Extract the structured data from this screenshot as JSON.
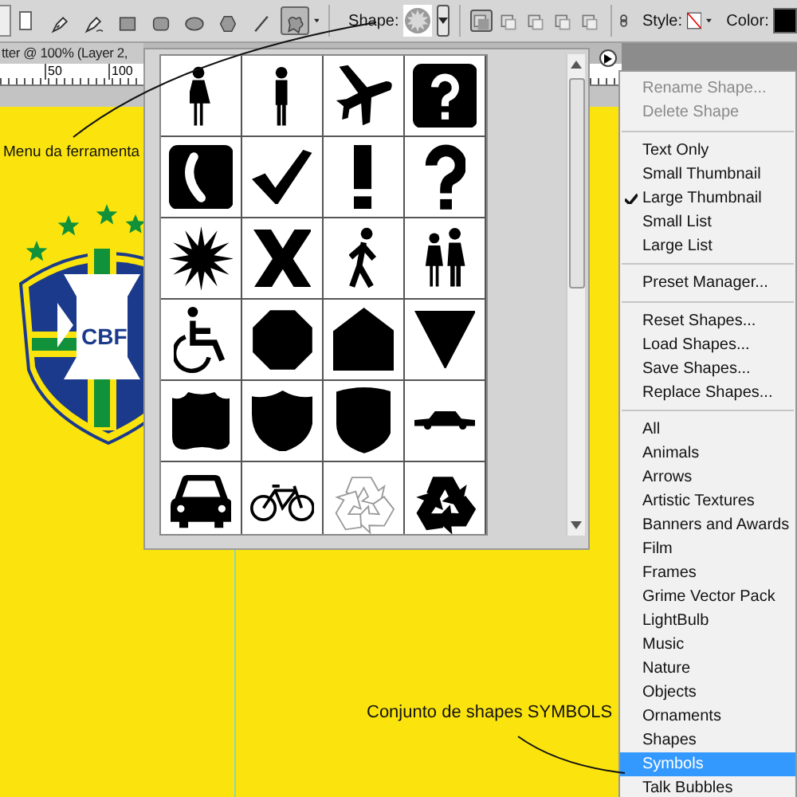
{
  "toolbar": {
    "tools": [
      {
        "selected": false
      },
      {
        "selected": false
      },
      {
        "selected": false
      },
      {
        "selected": false
      },
      {
        "selected": false
      },
      {
        "selected": false
      },
      {
        "selected": false
      },
      {
        "selected": true
      }
    ],
    "shape_label": "Shape:",
    "path_modes": [
      {
        "selected": true
      },
      {
        "selected": false
      },
      {
        "selected": false
      },
      {
        "selected": false
      },
      {
        "selected": false
      }
    ],
    "style_label": "Style:",
    "color_label": "Color:"
  },
  "document": {
    "tab_title": "tter @ 100% (Layer 2,",
    "ruler_labels": [
      "50",
      "100"
    ],
    "crest_text": "CBF"
  },
  "annotations": [
    {
      "text": "Menu da ferramenta"
    },
    {
      "text": "Conjunto de shapes SYMBOLS"
    }
  ],
  "shape_menu": {
    "groups": [
      [
        {
          "label": "Rename Shape...",
          "disabled": true,
          "checked": false,
          "selected": false
        },
        {
          "label": "Delete Shape",
          "disabled": true,
          "checked": false,
          "selected": false
        }
      ],
      [
        {
          "label": "Text Only",
          "disabled": false,
          "checked": false,
          "selected": false
        },
        {
          "label": "Small Thumbnail",
          "disabled": false,
          "checked": false,
          "selected": false
        },
        {
          "label": "Large Thumbnail",
          "disabled": false,
          "checked": true,
          "selected": false
        },
        {
          "label": "Small List",
          "disabled": false,
          "checked": false,
          "selected": false
        },
        {
          "label": "Large List",
          "disabled": false,
          "checked": false,
          "selected": false
        }
      ],
      [
        {
          "label": "Preset Manager...",
          "disabled": false,
          "checked": false,
          "selected": false
        }
      ],
      [
        {
          "label": "Reset Shapes...",
          "disabled": false,
          "checked": false,
          "selected": false
        },
        {
          "label": "Load Shapes...",
          "disabled": false,
          "checked": false,
          "selected": false
        },
        {
          "label": "Save Shapes...",
          "disabled": false,
          "checked": false,
          "selected": false
        },
        {
          "label": "Replace Shapes...",
          "disabled": false,
          "checked": false,
          "selected": false
        }
      ],
      [
        {
          "label": "All",
          "disabled": false,
          "checked": false,
          "selected": false
        },
        {
          "label": "Animals",
          "disabled": false,
          "checked": false,
          "selected": false
        },
        {
          "label": "Arrows",
          "disabled": false,
          "checked": false,
          "selected": false
        },
        {
          "label": "Artistic Textures",
          "disabled": false,
          "checked": false,
          "selected": false
        },
        {
          "label": "Banners and Awards",
          "disabled": false,
          "checked": false,
          "selected": false
        },
        {
          "label": "Film",
          "disabled": false,
          "checked": false,
          "selected": false
        },
        {
          "label": "Frames",
          "disabled": false,
          "checked": false,
          "selected": false
        },
        {
          "label": "Grime Vector Pack",
          "disabled": false,
          "checked": false,
          "selected": false
        },
        {
          "label": "LightBulb",
          "disabled": false,
          "checked": false,
          "selected": false
        },
        {
          "label": "Music",
          "disabled": false,
          "checked": false,
          "selected": false
        },
        {
          "label": "Nature",
          "disabled": false,
          "checked": false,
          "selected": false
        },
        {
          "label": "Objects",
          "disabled": false,
          "checked": false,
          "selected": false
        },
        {
          "label": "Ornaments",
          "disabled": false,
          "checked": false,
          "selected": false
        },
        {
          "label": "Shapes",
          "disabled": false,
          "checked": false,
          "selected": false
        },
        {
          "label": "Symbols",
          "disabled": false,
          "checked": false,
          "selected": true
        },
        {
          "label": "Talk Bubbles",
          "disabled": false,
          "checked": false,
          "selected": false
        }
      ]
    ]
  }
}
